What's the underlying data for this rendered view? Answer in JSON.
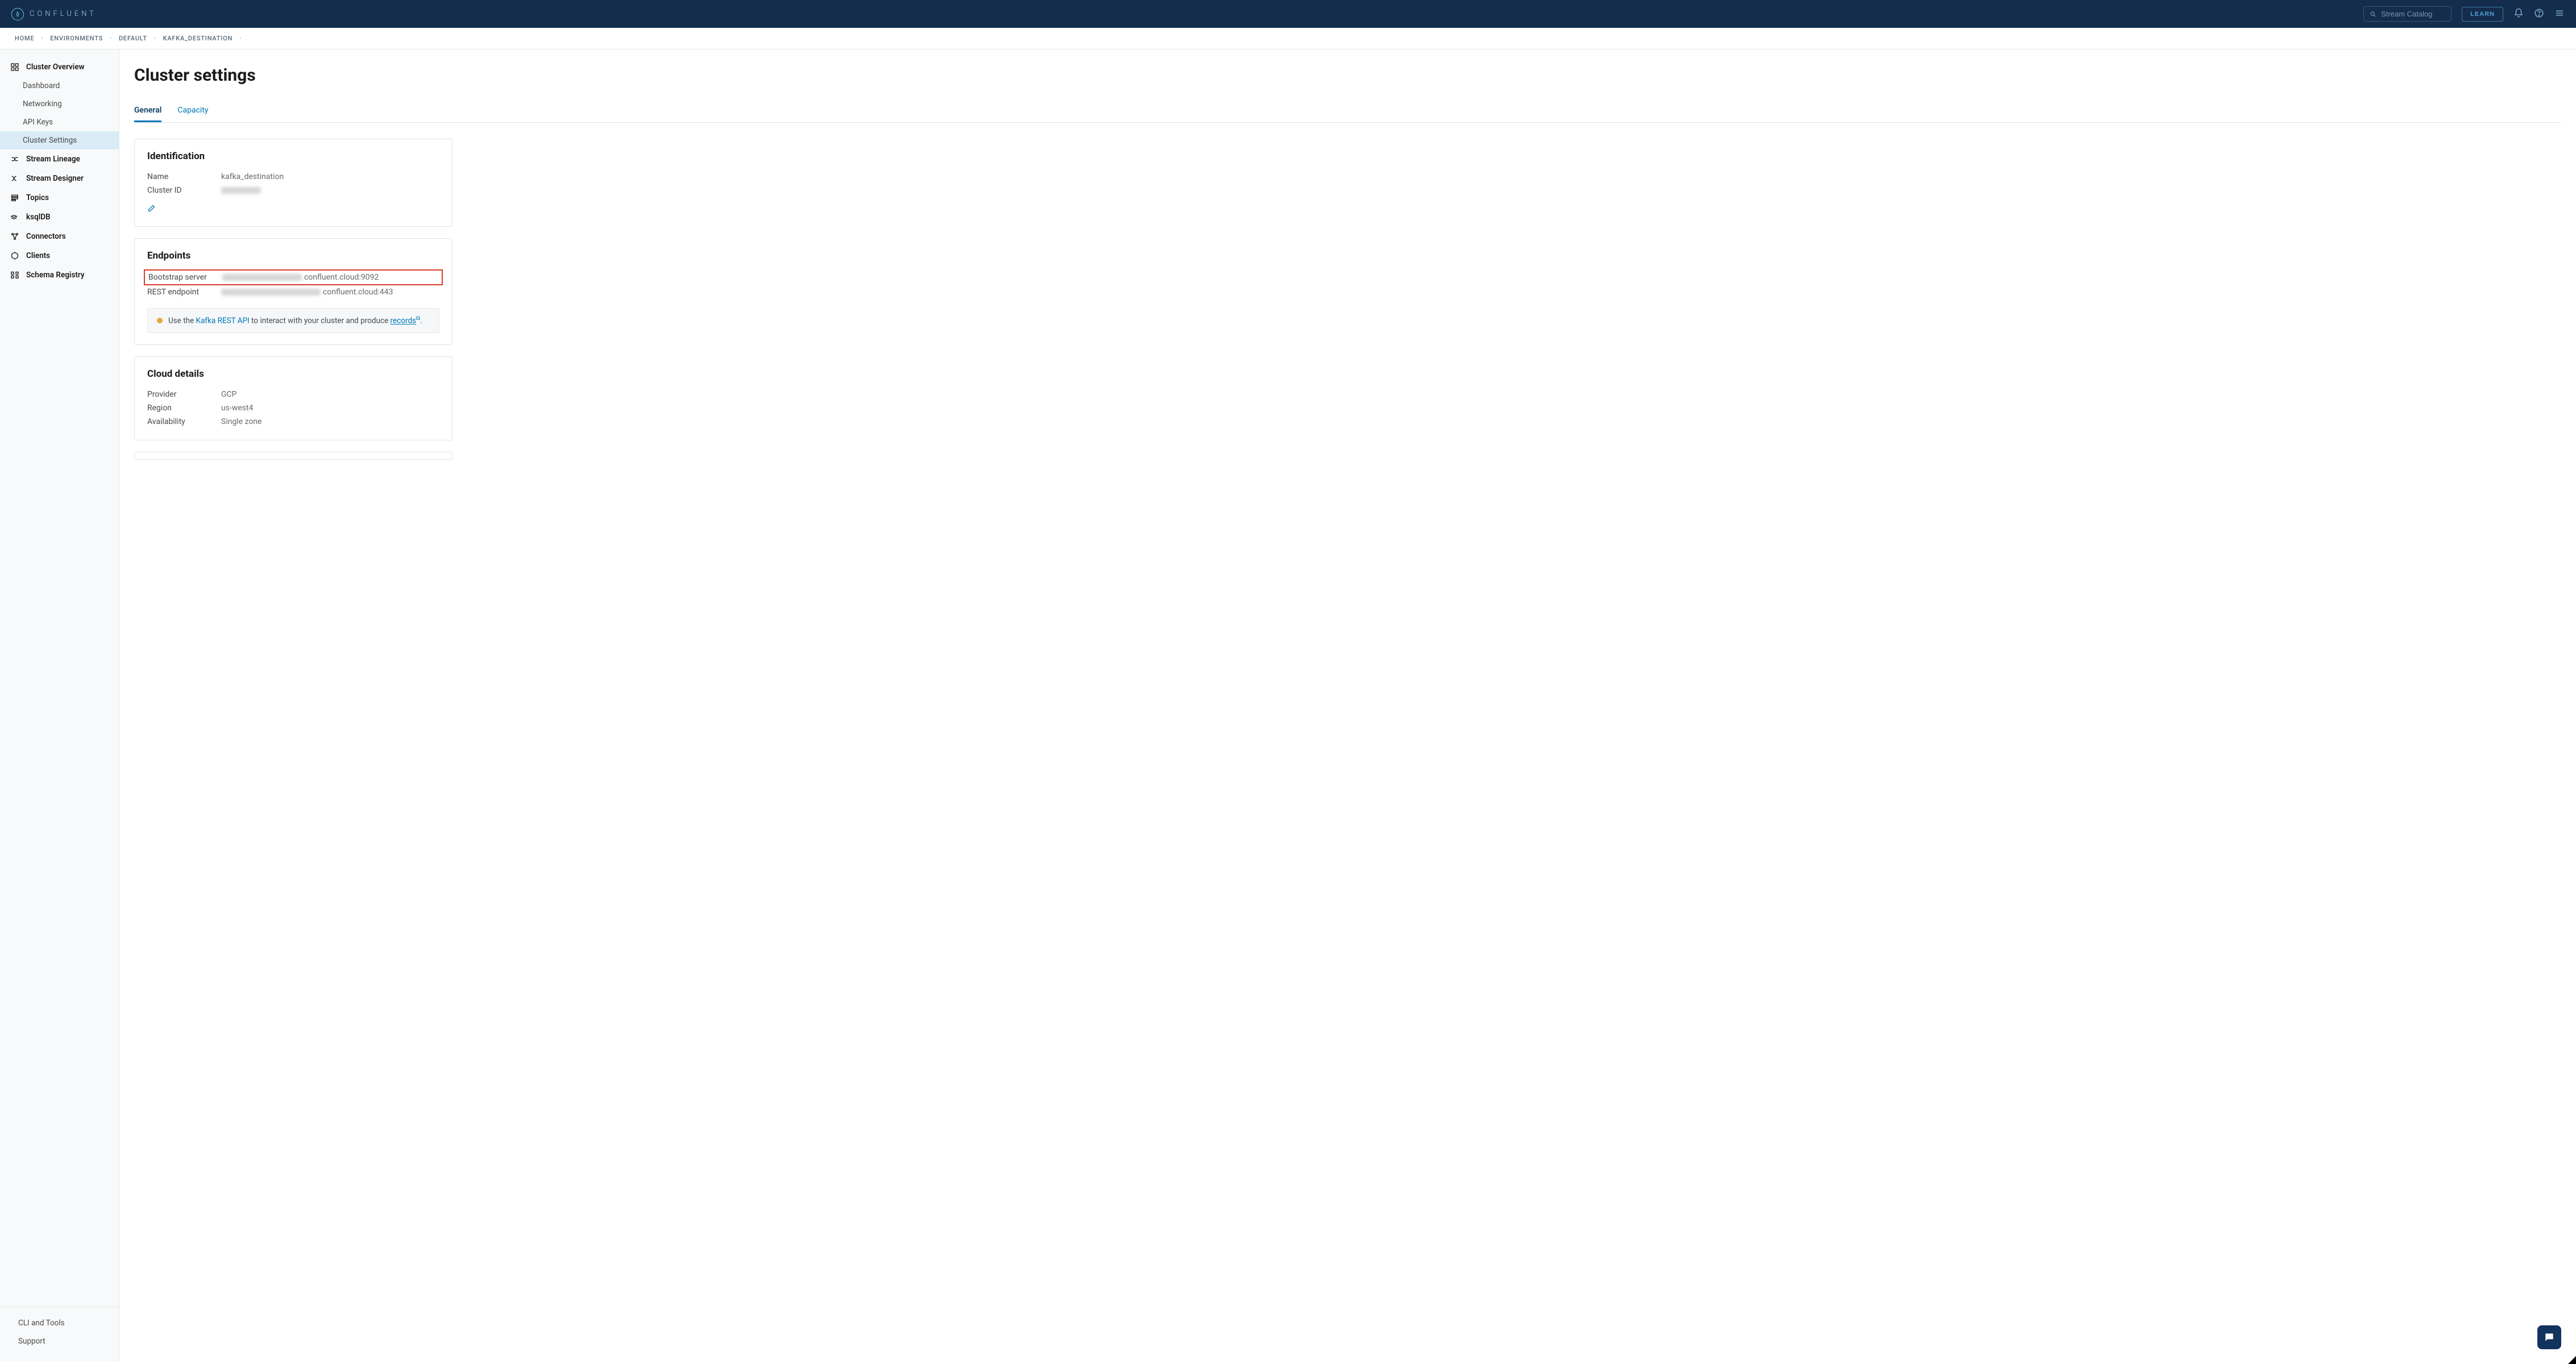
{
  "brand": {
    "name": "CONFLUENT"
  },
  "topbar": {
    "search_placeholder": "Stream Catalog",
    "learn_label": "LEARN"
  },
  "breadcrumb": [
    {
      "label": "HOME"
    },
    {
      "label": "ENVIRONMENTS"
    },
    {
      "label": "DEFAULT"
    },
    {
      "label": "KAFKA_DESTINATION"
    }
  ],
  "sidebar": {
    "items": [
      {
        "label": "Cluster Overview",
        "icon": "grid"
      },
      {
        "label": "Stream Lineage",
        "icon": "lineage"
      },
      {
        "label": "Stream Designer",
        "icon": "designer"
      },
      {
        "label": "Topics",
        "icon": "topics"
      },
      {
        "label": "ksqlDB",
        "icon": "ksql"
      },
      {
        "label": "Connectors",
        "icon": "connectors"
      },
      {
        "label": "Clients",
        "icon": "clients"
      },
      {
        "label": "Schema Registry",
        "icon": "schema"
      }
    ],
    "sub_overview": [
      {
        "label": "Dashboard"
      },
      {
        "label": "Networking"
      },
      {
        "label": "API Keys"
      },
      {
        "label": "Cluster Settings",
        "active": true
      }
    ],
    "bottom": [
      {
        "label": "CLI and Tools"
      },
      {
        "label": "Support"
      }
    ]
  },
  "page": {
    "title": "Cluster settings",
    "tabs": [
      {
        "label": "General",
        "active": true
      },
      {
        "label": "Capacity",
        "active": false
      }
    ]
  },
  "identification": {
    "heading": "Identification",
    "name_label": "Name",
    "name_value": "kafka_destination",
    "clusterid_label": "Cluster ID"
  },
  "endpoints": {
    "heading": "Endpoints",
    "bootstrap_label": "Bootstrap server",
    "bootstrap_suffix": "confluent.cloud:9092",
    "rest_label": "REST endpoint",
    "rest_suffix": "confluent.cloud:443",
    "info_prefix": "Use the ",
    "info_api_link": "Kafka REST API",
    "info_mid": " to interact with your cluster and produce ",
    "info_records_link": "records",
    "info_suffix": "."
  },
  "cloud": {
    "heading": "Cloud details",
    "provider_label": "Provider",
    "provider_value": "GCP",
    "region_label": "Region",
    "region_value": "us-west4",
    "availability_label": "Availability",
    "availability_value": "Single zone"
  }
}
